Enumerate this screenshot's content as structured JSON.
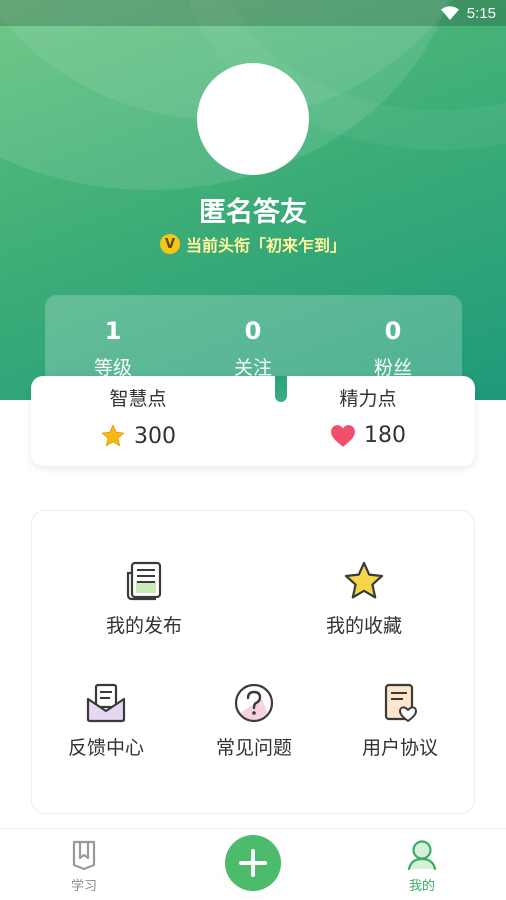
{
  "status_bar": {
    "time": "5:15"
  },
  "profile": {
    "username": "匿名答友",
    "badge": "V",
    "title_text": "当前头衔「初来乍到」"
  },
  "stats": [
    {
      "value": "1",
      "label": "等级"
    },
    {
      "value": "0",
      "label": "关注"
    },
    {
      "value": "0",
      "label": "粉丝"
    }
  ],
  "points": {
    "wisdom": {
      "label": "智慧点",
      "value": "300",
      "icon": "star-icon"
    },
    "energy": {
      "label": "精力点",
      "value": "180",
      "icon": "heart-icon"
    }
  },
  "menu": {
    "items": [
      {
        "label": "我的发布",
        "icon": "newspaper-icon"
      },
      {
        "label": "我的收藏",
        "icon": "star-outline-icon"
      },
      {
        "label": "反馈中心",
        "icon": "mail-icon"
      },
      {
        "label": "常见问题",
        "icon": "question-icon"
      },
      {
        "label": "用户协议",
        "icon": "document-heart-icon"
      }
    ]
  },
  "tab_bar": {
    "tabs": [
      {
        "label": "学习",
        "icon": "book-icon",
        "active": false
      },
      {
        "label": "我的",
        "icon": "user-icon",
        "active": true
      }
    ],
    "center_icon": "plus-icon"
  },
  "colors": {
    "accent": "#4cbb6b",
    "header_start": "#5fc27a",
    "header_end": "#1e9a7a",
    "title_yellow": "#fff59d"
  }
}
